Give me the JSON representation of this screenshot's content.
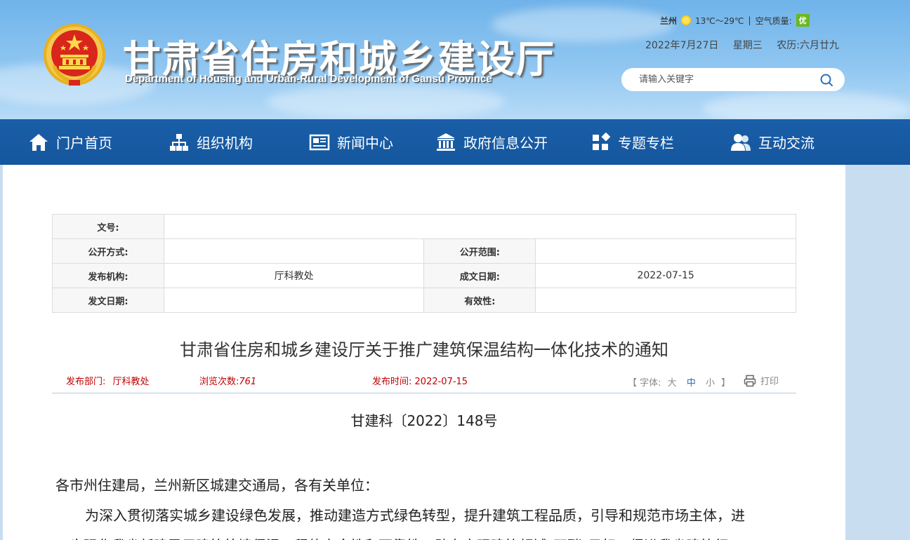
{
  "header": {
    "title": "甘肃省住房和城乡建设厅",
    "subtitle": "Department of Housing and Urban-Rural Development of Gansu Province",
    "emblem_icon": "national-emblem-icon"
  },
  "weather": {
    "city": "兰州",
    "temp_range": "13℃～29℃",
    "separator": "|",
    "air_label": "空气质量:",
    "air_value": "优",
    "air_color": "#6bb81f"
  },
  "date": {
    "date": "2022年7月27日",
    "weekday": "星期三",
    "lunar": "农历:六月廿九"
  },
  "search": {
    "placeholder": "请输入关键字",
    "icon": "search-icon"
  },
  "nav": {
    "items": [
      {
        "label": "门户首页",
        "icon": "home-icon"
      },
      {
        "label": "组织机构",
        "icon": "org-chart-icon"
      },
      {
        "label": "新闻中心",
        "icon": "newspaper-icon"
      },
      {
        "label": "政府信息公开",
        "icon": "government-building-icon"
      },
      {
        "label": "专题专栏",
        "icon": "grid-icon"
      },
      {
        "label": "互动交流",
        "icon": "users-icon"
      }
    ],
    "bg_color": "#1a5ea8"
  },
  "meta": {
    "doc_no_label": "文号:",
    "doc_no_value": "",
    "disclosure_label": "公开方式:",
    "disclosure_value": "",
    "scope_label": "公开范围:",
    "scope_value": "",
    "issuer_label": "发布机构:",
    "issuer_value": "厅科教处",
    "created_label": "成文日期:",
    "created_value": "2022-07-15",
    "issued_label": "发文日期:",
    "issued_value": "",
    "validity_label": "有效性:",
    "validity_value": ""
  },
  "article": {
    "title": "甘肃省住房和城乡建设厅关于推广建筑保温结构一体化技术的通知",
    "dept_label": "发布部门:",
    "dept_value": "厅科教处",
    "views_label": "浏览次数:",
    "views_value": "761",
    "time_label": "发布时间:",
    "time_value": "2022-07-15",
    "font_label": "【 字体:",
    "font_large": "大",
    "font_medium": "中",
    "font_small": "小",
    "font_close": "】",
    "print_label": "打印",
    "doc_number": "甘建科〔2022〕148号",
    "salutation": "各市州住建局，兰州新区城建交通局，各有关单位：",
    "para1_line1": "为深入贯彻落实城乡建设绿色发展，推动建造方式绿色转型，提升建筑工程品质，引导和规范市场主体，进",
    "para1_line2": "一步强化我省新建民用建筑外墙保温工程的安全性和可靠性，助力实现建筑领域\"双碳\"目标，促进我省建筑行"
  }
}
